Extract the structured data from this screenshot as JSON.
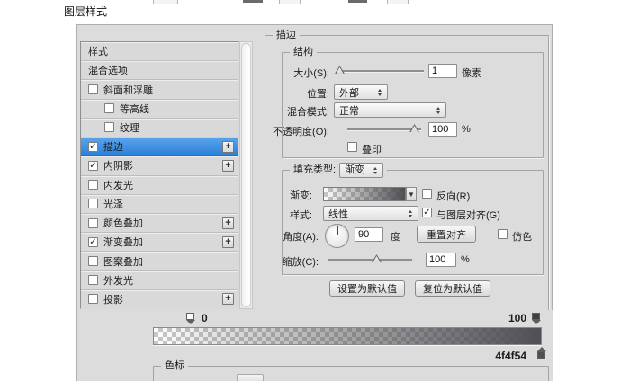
{
  "page": {
    "title": "图层样式"
  },
  "sidebar": {
    "plus_glyph": "+",
    "items": [
      {
        "label": "样式"
      },
      {
        "label": "混合选项"
      },
      {
        "label": "斜面和浮雕",
        "checkmark": ""
      },
      {
        "label": "等高线",
        "checkmark": ""
      },
      {
        "label": "纹理",
        "checkmark": ""
      },
      {
        "label": "描边",
        "checkmark": "✓"
      },
      {
        "label": "内阴影",
        "checkmark": "✓"
      },
      {
        "label": "内发光",
        "checkmark": ""
      },
      {
        "label": "光泽",
        "checkmark": ""
      },
      {
        "label": "颜色叠加",
        "checkmark": ""
      },
      {
        "label": "渐变叠加",
        "checkmark": "✓"
      },
      {
        "label": "图案叠加",
        "checkmark": ""
      },
      {
        "label": "外发光",
        "checkmark": ""
      },
      {
        "label": "投影",
        "checkmark": ""
      }
    ]
  },
  "stroke": {
    "group_title": "描边",
    "structure": {
      "title": "结构",
      "size_label": "大小(S):",
      "size_value": "1",
      "size_unit": "像素",
      "position_label": "位置:",
      "position_value": "外部",
      "blend_label": "混合模式:",
      "blend_value": "正常",
      "opacity_label": "不透明度(O):",
      "opacity_value": "100",
      "opacity_unit": "%",
      "overprint_label": "叠印",
      "overprint_check": ""
    },
    "fill": {
      "type_label": "填充类型:",
      "type_value": "渐变",
      "gradient_label": "渐变:",
      "gradient_arrow": "▼",
      "reverse_label": "反向(R)",
      "reverse_check": "",
      "style_label": "样式:",
      "style_value": "线性",
      "align_label": "与图层对齐(G)",
      "align_check": "✓",
      "angle_label": "角度(A):",
      "angle_value": "90",
      "angle_unit": "度",
      "reset_align_button": "重置对齐",
      "dither_label": "仿色",
      "dither_check": "",
      "scale_label": "缩放(C):",
      "scale_value": "100",
      "scale_unit": "%"
    },
    "make_default_button": "设置为默认值",
    "reset_default_button": "复位为默认值"
  },
  "gradient_editor": {
    "left_stop_label": "0",
    "right_stop_label": "100",
    "color_value": "4f4f54",
    "stops_group_title": "色标",
    "gradient_end_color": "#4f4f54"
  },
  "colors": {
    "selection_blue": "#3a8fe4",
    "gradient_end": "#4f4f54",
    "dialog_bg": "#dcdcdc"
  }
}
